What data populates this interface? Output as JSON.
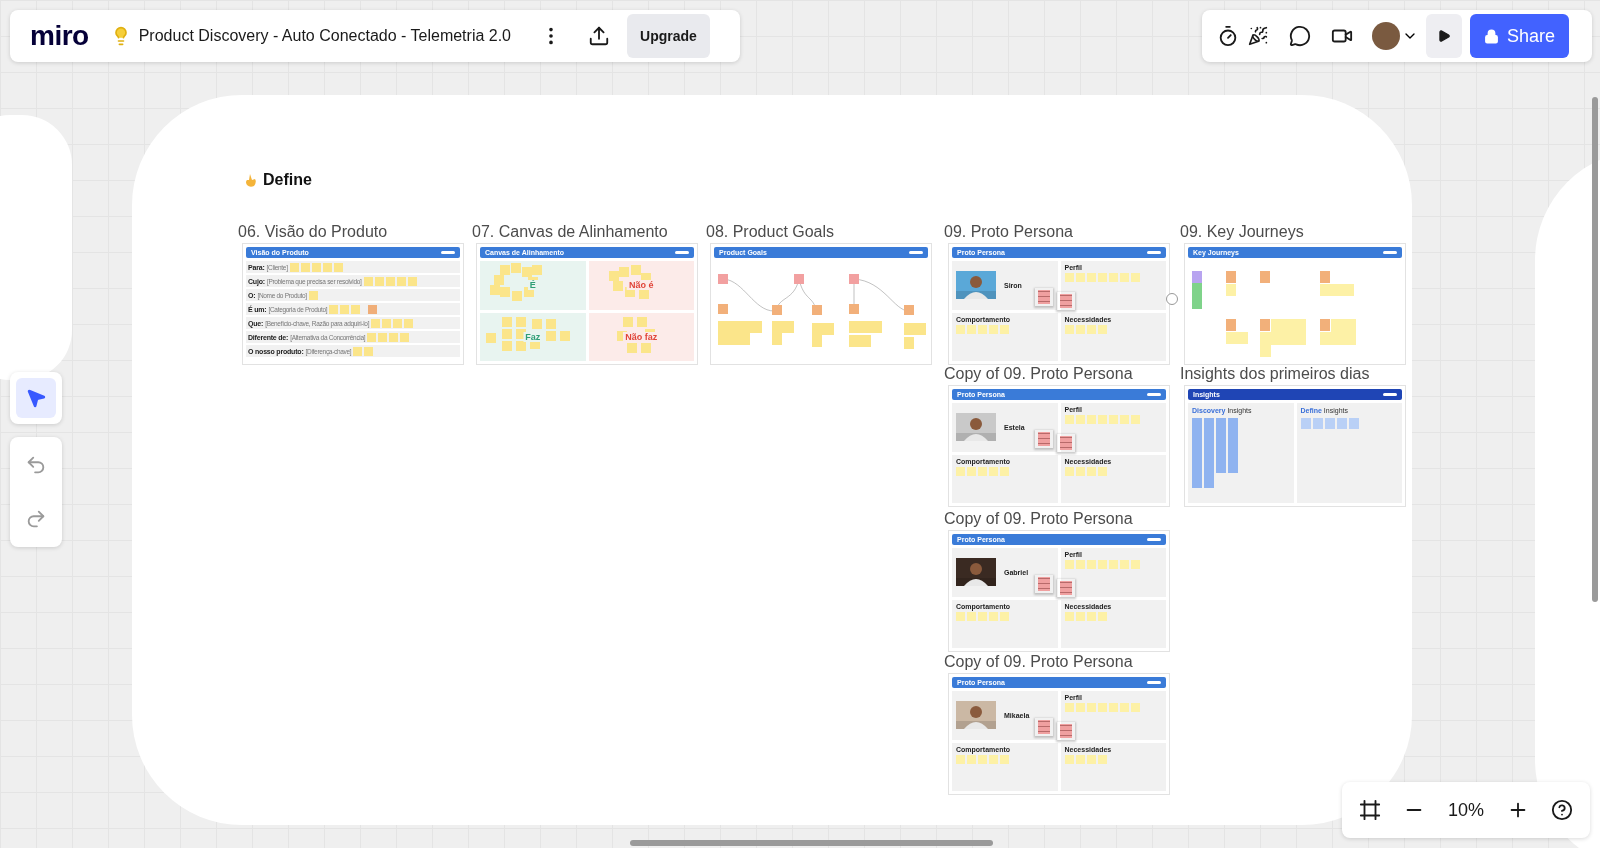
{
  "toolbar": {
    "logo": "miro",
    "board_title": "Product Discovery - Auto Conectado - Telemetria 2.0",
    "upgrade_button": "Upgrade"
  },
  "share": {
    "label": "Share"
  },
  "section": {
    "title": "Define"
  },
  "frames": [
    {
      "kind": "vision",
      "title": "06. Visão do Produto",
      "header": "Visão do Produto",
      "rows": [
        {
          "label": "Para:",
          "note": "[Cliente]"
        },
        {
          "label": "Cujo:",
          "note": "[Problema que precisa ser resolvido]"
        },
        {
          "label": "O:",
          "note": "[Nome do Produto]"
        },
        {
          "label": "É um:",
          "note": "[Categoria de Produto]"
        },
        {
          "label": "Que:",
          "note": "[Benefício-chave, Razão para adquiri-lo]"
        },
        {
          "label": "Diferente de:",
          "note": "[Alternativa da Concorrência]"
        },
        {
          "label": "O nosso produto:",
          "note": "[Diferença-chave]"
        }
      ]
    },
    {
      "kind": "canvas",
      "title": "07. Canvas de Alinhamento",
      "header": "Canvas de Alinhamento",
      "quadrants": [
        {
          "label": "É",
          "color": "#2f9e76"
        },
        {
          "label": "Não é",
          "color": "#e0453a"
        },
        {
          "label": "Faz",
          "color": "#2f9e76"
        },
        {
          "label": "Não faz",
          "color": "#e0453a"
        }
      ]
    },
    {
      "kind": "goals",
      "title": "08. Product Goals",
      "header": "Product Goals"
    },
    {
      "kind": "persona",
      "title": "09. Proto Persona",
      "header": "Proto Persona",
      "name": "Siron",
      "sections": [
        "Perfil",
        "Comportamento",
        "Necessidades"
      ]
    },
    {
      "kind": "journeys",
      "title": "09. Key Journeys",
      "header": "Key Journeys"
    },
    {
      "kind": "persona",
      "title": "Copy of 09. Proto Persona",
      "header": "Proto Persona",
      "name": "Estela",
      "sections": [
        "Perfil",
        "Comportamento",
        "Necessidades"
      ]
    },
    {
      "kind": "insights",
      "title": "Insights dos primeiros dias",
      "header": "Insights",
      "panels": [
        "**Discovery** Insights",
        "**Define** Insights"
      ]
    },
    {
      "kind": "persona",
      "title": "Copy of 09. Proto Persona",
      "header": "Proto Persona",
      "name": "Gabriel",
      "sections": [
        "Perfil",
        "Comportamento",
        "Necessidades"
      ]
    },
    {
      "kind": "persona",
      "title": "Copy of 09. Proto Persona",
      "header": "Proto Persona",
      "name": "Mikaela",
      "sections": [
        "Perfil",
        "Comportamento",
        "Necessidades"
      ]
    }
  ],
  "zoom": {
    "value": "10%"
  }
}
